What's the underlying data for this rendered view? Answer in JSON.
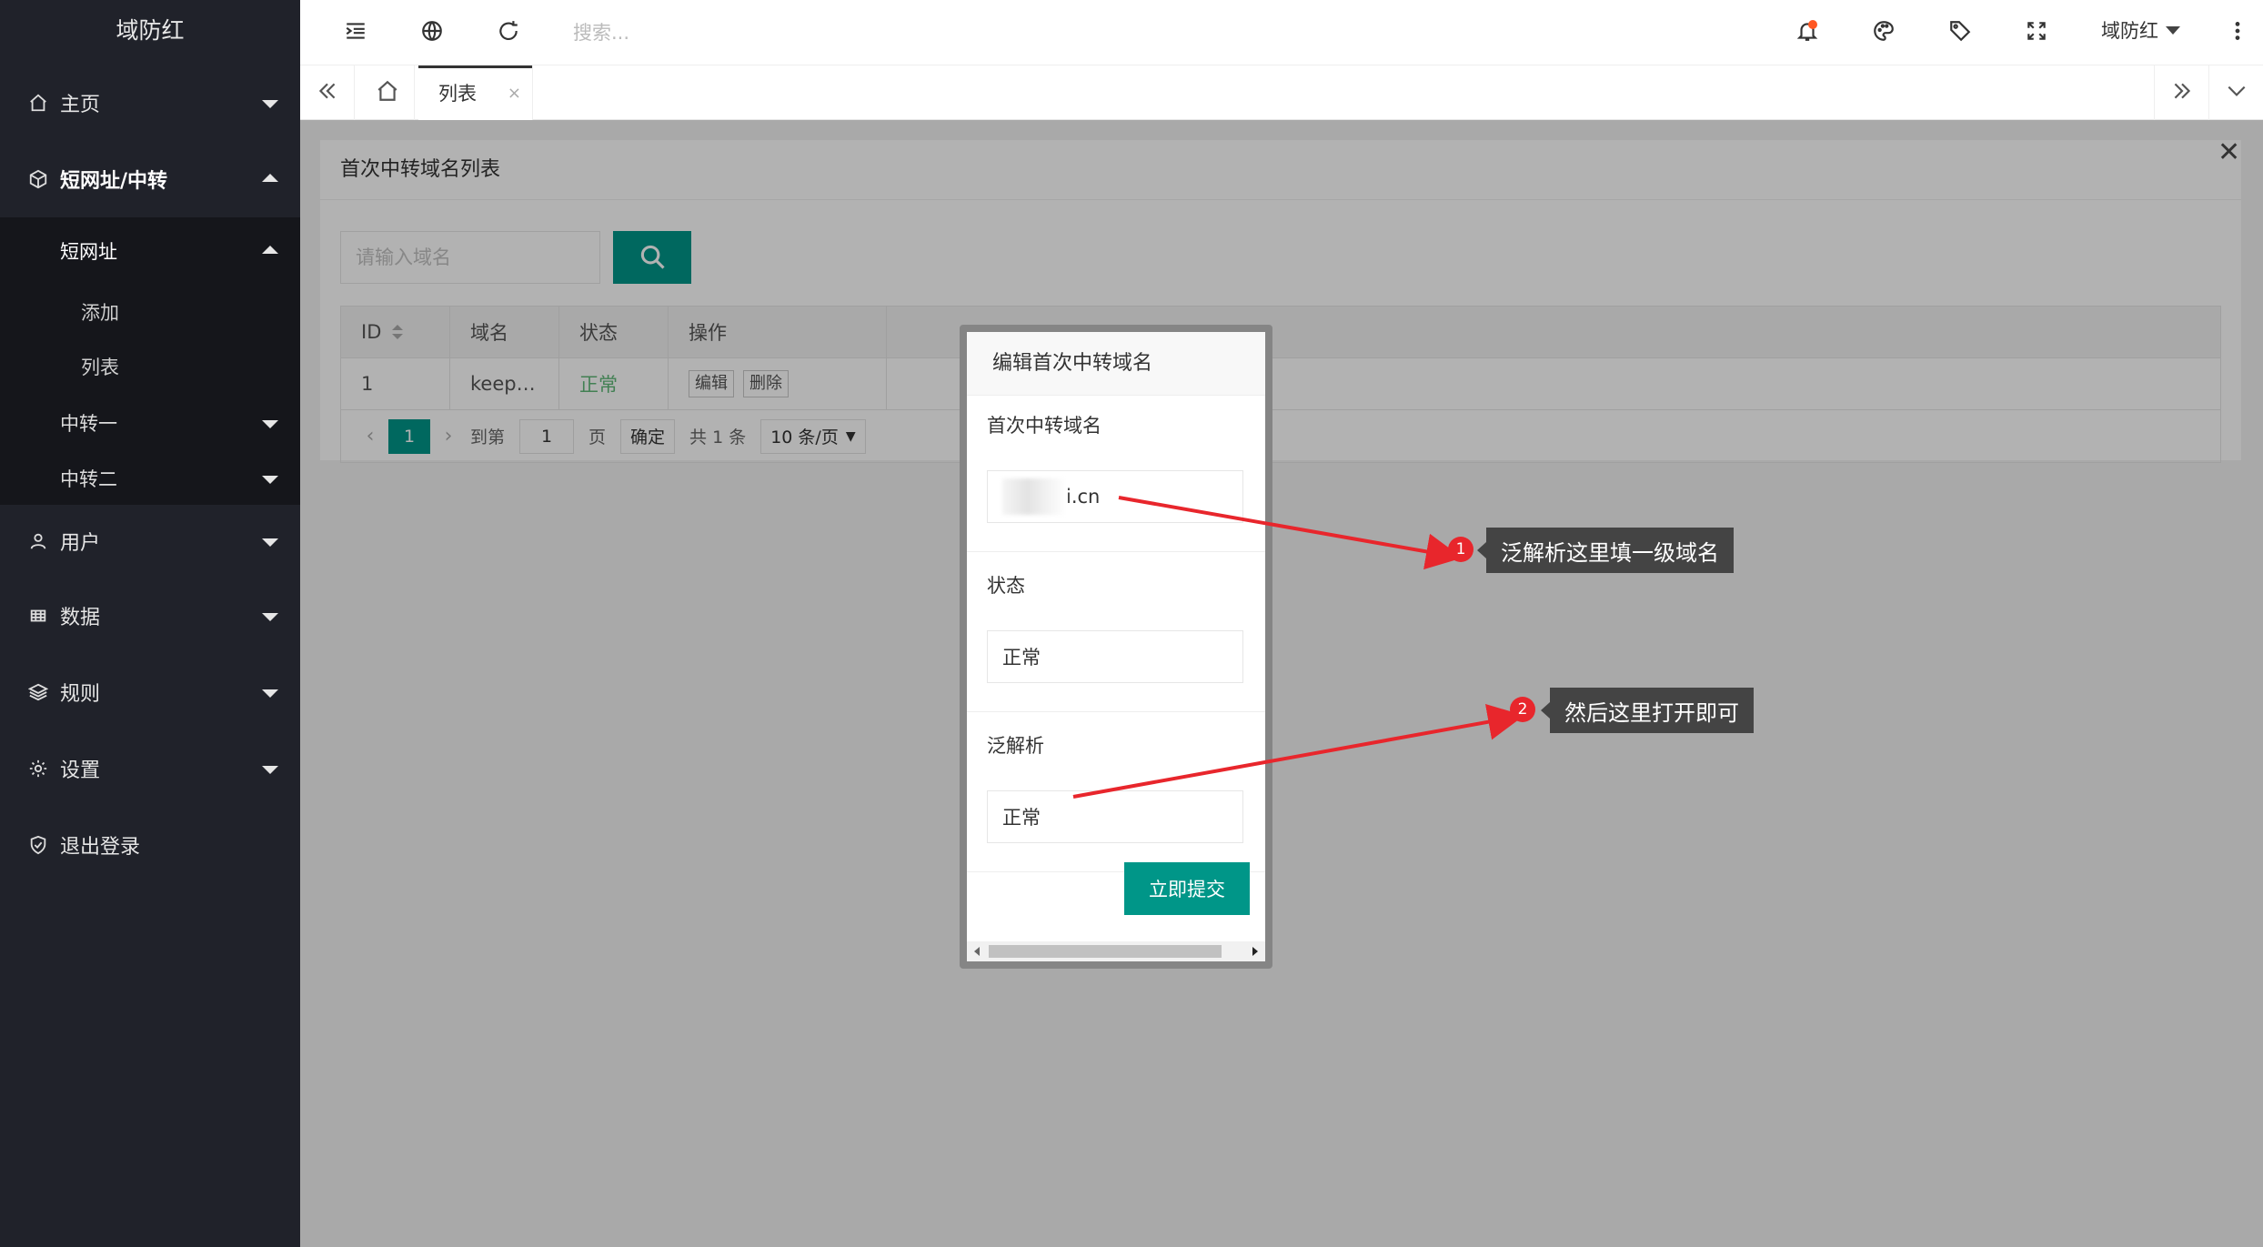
{
  "sidebar": {
    "logo": "域防红",
    "items": {
      "home": "主页",
      "shorturl_group": "短网址/中转",
      "shorturl": "短网址",
      "add": "添加",
      "list": "列表",
      "relay1": "中转一",
      "relay2": "中转二",
      "users": "用户",
      "data": "数据",
      "rules": "规则",
      "settings": "设置",
      "logout": "退出登录"
    }
  },
  "header": {
    "search_placeholder": "搜索...",
    "user_name": "域防红"
  },
  "tabs": {
    "current": "列表",
    "close": "×"
  },
  "card": {
    "title": "首次中转域名列表",
    "search_placeholder": "请输入域名",
    "table": {
      "headers": [
        "ID",
        "域名",
        "状态",
        "操作"
      ],
      "rows": [
        {
          "id": "1",
          "domain": "keep…",
          "status": "正常",
          "edit": "编辑",
          "delete": "删除"
        }
      ]
    },
    "pager": {
      "current_page": "1",
      "goto_label": "到第",
      "goto_value": "1",
      "page_unit": "页",
      "confirm": "确定",
      "total": "共 1 条",
      "per_page": "10 条/页"
    }
  },
  "dialog": {
    "title": "编辑首次中转域名",
    "field1_label": "首次中转域名",
    "field1_value": "i.cn",
    "field2_label": "状态",
    "field2_value": "正常",
    "field3_label": "泛解析",
    "field3_value": "正常",
    "submit": "立即提交"
  },
  "annotations": [
    {
      "num": "1",
      "text": "泛解析这里填一级域名"
    },
    {
      "num": "2",
      "text": "然后这里打开即可"
    }
  ],
  "colors": {
    "sidebar_bg": "#20222a",
    "primary": "#009688",
    "status_ok": "#5fb878",
    "annotation_red": "#e8262c",
    "tooltip_bg": "#444444"
  },
  "icons": {
    "home": "home-icon",
    "shorturl": "cube-icon",
    "users": "user-icon",
    "data": "grid-icon",
    "rules": "layers-icon",
    "settings": "gear-icon",
    "logout": "shield-check-icon"
  }
}
